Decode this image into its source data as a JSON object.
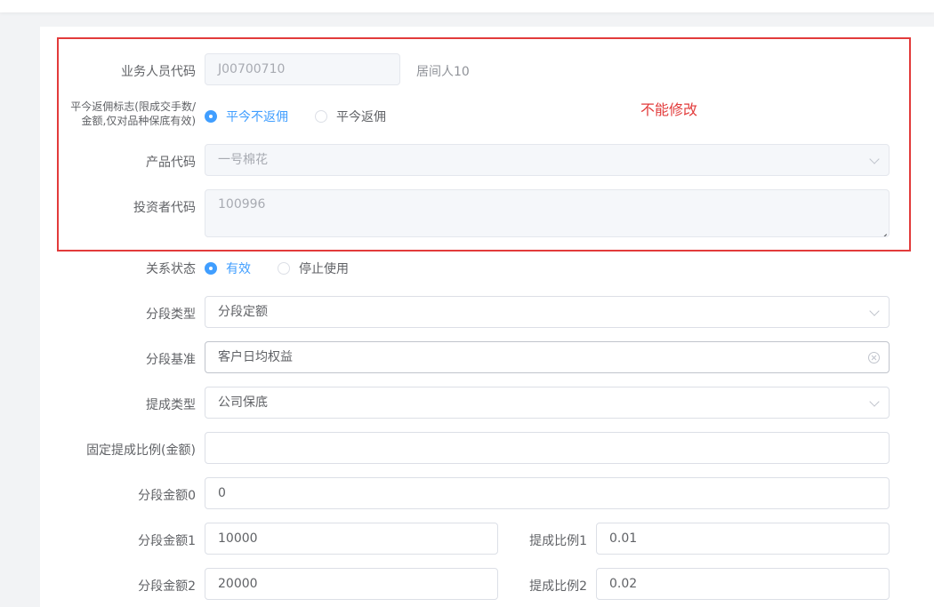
{
  "form": {
    "staff_code": {
      "label": "业务人员代码",
      "value": "J00700710",
      "hint": "居间人10"
    },
    "close_rebate": {
      "label": "平今返佣标志(限成交手数/金额,仅对品种保底有效)",
      "options": [
        "平今不返佣",
        "平今返佣"
      ],
      "selected": "平今不返佣"
    },
    "product_code": {
      "label": "产品代码",
      "value": "一号棉花"
    },
    "investor_code": {
      "label": "投资者代码",
      "value": "100996"
    },
    "relation_status": {
      "label": "关系状态",
      "options": [
        "有效",
        "停止使用"
      ],
      "selected": "有效"
    },
    "segment_type": {
      "label": "分段类型",
      "value": "分段定额"
    },
    "segment_base": {
      "label": "分段基准",
      "value": "客户日均权益"
    },
    "commission_type": {
      "label": "提成类型",
      "value": "公司保底"
    },
    "fixed_ratio": {
      "label": "固定提成比例(金额)",
      "value": ""
    },
    "segment_amount0": {
      "label": "分段金额0",
      "value": "0"
    },
    "segment_amount1": {
      "label": "分段金额1",
      "value": "10000"
    },
    "commission_ratio1": {
      "label": "提成比例1",
      "value": "0.01"
    },
    "segment_amount2": {
      "label": "分段金额2",
      "value": "20000"
    },
    "commission_ratio2": {
      "label": "提成比例2",
      "value": "0.02"
    }
  },
  "annotation": {
    "text": "不能修改",
    "color": "#e23b3b"
  },
  "colors": {
    "accent": "#409eff",
    "annotation": "#e23b3b",
    "disabled_bg": "#f5f7fa"
  }
}
